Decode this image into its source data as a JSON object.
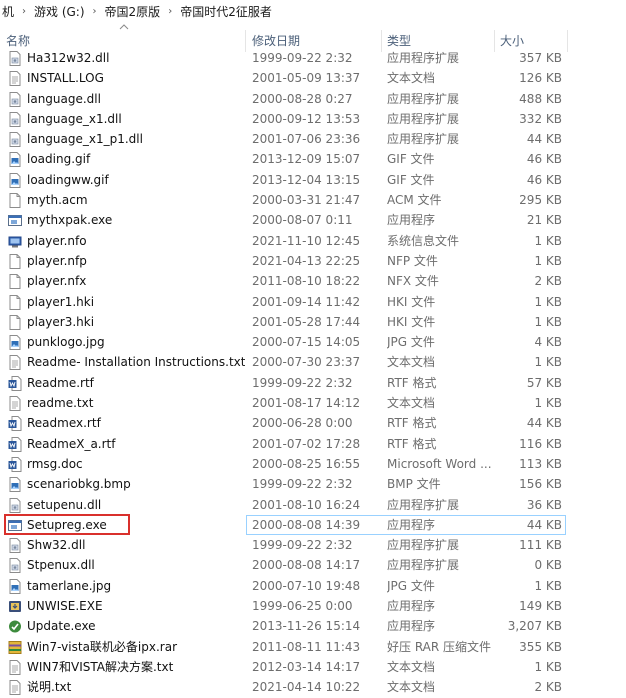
{
  "breadcrumb": [
    "机",
    "游戏 (G:)",
    "帝国2原版",
    "帝国时代2征服者"
  ],
  "columns": {
    "name": "名称",
    "date": "修改日期",
    "type": "类型",
    "size": "大小"
  },
  "files": [
    {
      "name": "Ha312w32.dll",
      "date": "1999-09-22 2:32",
      "type": "应用程序扩展",
      "size": "357 KB",
      "icon": "dll-icon"
    },
    {
      "name": "INSTALL.LOG",
      "date": "2001-05-09 13:37",
      "type": "文本文档",
      "size": "126 KB",
      "icon": "text-file-icon"
    },
    {
      "name": "language.dll",
      "date": "2000-08-28 0:27",
      "type": "应用程序扩展",
      "size": "488 KB",
      "icon": "dll-icon"
    },
    {
      "name": "language_x1.dll",
      "date": "2000-09-12 13:53",
      "type": "应用程序扩展",
      "size": "332 KB",
      "icon": "dll-icon"
    },
    {
      "name": "language_x1_p1.dll",
      "date": "2001-07-06 23:36",
      "type": "应用程序扩展",
      "size": "44 KB",
      "icon": "dll-icon"
    },
    {
      "name": "loading.gif",
      "date": "2013-12-09 15:07",
      "type": "GIF 文件",
      "size": "46 KB",
      "icon": "image-file-icon"
    },
    {
      "name": "loadingww.gif",
      "date": "2013-12-04 13:15",
      "type": "GIF 文件",
      "size": "46 KB",
      "icon": "image-file-icon"
    },
    {
      "name": "myth.acm",
      "date": "2000-03-31 21:47",
      "type": "ACM 文件",
      "size": "295 KB",
      "icon": "blank-file-icon"
    },
    {
      "name": "mythxpak.exe",
      "date": "2000-08-07 0:11",
      "type": "应用程序",
      "size": "21 KB",
      "icon": "exe-icon"
    },
    {
      "name": "player.nfo",
      "date": "2021-11-10 12:45",
      "type": "系统信息文件",
      "size": "1 KB",
      "icon": "sysinfo-file-icon"
    },
    {
      "name": "player.nfp",
      "date": "2021-04-13 22:25",
      "type": "NFP 文件",
      "size": "1 KB",
      "icon": "blank-file-icon"
    },
    {
      "name": "player.nfx",
      "date": "2011-08-10 18:22",
      "type": "NFX 文件",
      "size": "2 KB",
      "icon": "blank-file-icon"
    },
    {
      "name": "player1.hki",
      "date": "2001-09-14 11:42",
      "type": "HKI 文件",
      "size": "1 KB",
      "icon": "blank-file-icon"
    },
    {
      "name": "player3.hki",
      "date": "2001-05-28 17:44",
      "type": "HKI 文件",
      "size": "1 KB",
      "icon": "blank-file-icon"
    },
    {
      "name": "punklogo.jpg",
      "date": "2000-07-15 14:05",
      "type": "JPG 文件",
      "size": "4 KB",
      "icon": "image-file-icon"
    },
    {
      "name": "Readme- Installation Instructions.txt",
      "date": "2000-07-30 23:37",
      "type": "文本文档",
      "size": "1 KB",
      "icon": "text-file-icon"
    },
    {
      "name": "Readme.rtf",
      "date": "1999-09-22 2:32",
      "type": "RTF 格式",
      "size": "57 KB",
      "icon": "word-doc-icon"
    },
    {
      "name": "readme.txt",
      "date": "2001-08-17 14:12",
      "type": "文本文档",
      "size": "1 KB",
      "icon": "text-file-icon"
    },
    {
      "name": "Readmex.rtf",
      "date": "2000-06-28 0:00",
      "type": "RTF 格式",
      "size": "44 KB",
      "icon": "word-doc-icon"
    },
    {
      "name": "ReadmeX_a.rtf",
      "date": "2001-07-02 17:28",
      "type": "RTF 格式",
      "size": "116 KB",
      "icon": "word-doc-icon"
    },
    {
      "name": "rmsg.doc",
      "date": "2000-08-25 16:55",
      "type": "Microsoft Word ...",
      "size": "113 KB",
      "icon": "word-doc-icon"
    },
    {
      "name": "scenariobkg.bmp",
      "date": "1999-09-22 2:32",
      "type": "BMP 文件",
      "size": "156 KB",
      "icon": "image-file-icon"
    },
    {
      "name": "setupenu.dll",
      "date": "2001-08-10 16:24",
      "type": "应用程序扩展",
      "size": "36 KB",
      "icon": "dll-icon"
    },
    {
      "name": "Setupreg.exe",
      "date": "2000-08-08 14:39",
      "type": "应用程序",
      "size": "44 KB",
      "icon": "exe-icon"
    },
    {
      "name": "Shw32.dll",
      "date": "1999-09-22 2:32",
      "type": "应用程序扩展",
      "size": "111 KB",
      "icon": "dll-icon"
    },
    {
      "name": "Stpenux.dll",
      "date": "2000-08-08 14:17",
      "type": "应用程序扩展",
      "size": "0 KB",
      "icon": "dll-icon"
    },
    {
      "name": "tamerlane.jpg",
      "date": "2000-07-10 19:48",
      "type": "JPG 文件",
      "size": "1 KB",
      "icon": "image-file-icon"
    },
    {
      "name": "UNWISE.EXE",
      "date": "1999-06-25 0:00",
      "type": "应用程序",
      "size": "149 KB",
      "icon": "installer-icon"
    },
    {
      "name": "Update.exe",
      "date": "2013-11-26 15:14",
      "type": "应用程序",
      "size": "3,207 KB",
      "icon": "update-app-icon"
    },
    {
      "name": "Win7-vista联机必备ipx.rar",
      "date": "2011-08-11 11:43",
      "type": "好压 RAR 压缩文件",
      "size": "355 KB",
      "icon": "archive-icon"
    },
    {
      "name": "WIN7和VISTA解决方案.txt",
      "date": "2012-03-14 14:17",
      "type": "文本文档",
      "size": "1 KB",
      "icon": "text-file-icon"
    },
    {
      "name": "说明.txt",
      "date": "2021-04-14 10:22",
      "type": "文本文档",
      "size": "2 KB",
      "icon": "text-file-icon"
    }
  ],
  "highlighted_file": "Setupreg.exe",
  "highlight_color": "#d9302c"
}
